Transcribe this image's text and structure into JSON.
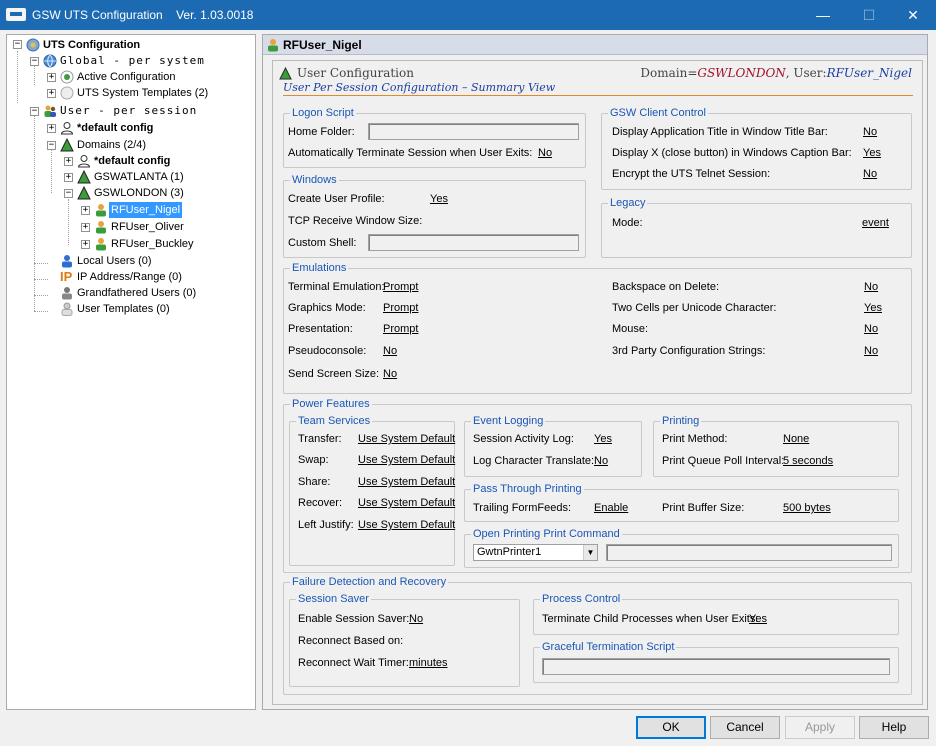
{
  "window": {
    "title": "GSW UTS Configuration",
    "version": "Ver. 1.03.0018",
    "minimize": "—",
    "maximize": "☐",
    "close": "✕"
  },
  "tree": {
    "root": "UTS Configuration",
    "global": "Global - per system",
    "active_config": "Active Configuration",
    "uts_templates": "UTS System Templates (2)",
    "user": "User - per session",
    "default_config": "*default config",
    "domains": "Domains (2/4)",
    "domain_default": "*default config",
    "gswatlanta": "GSWATLANTA (1)",
    "gswlondon": "GSWLONDON (3)",
    "users": [
      "RFUser_Nigel",
      "RFUser_Oliver",
      "RFUser_Buckley"
    ],
    "local_users": "Local Users (0)",
    "ip_address": "IP Address/Range (0)",
    "grandfathered": "Grandfathered Users (0)",
    "user_templates": "User Templates (0)",
    "ip_text": "IP"
  },
  "main": {
    "header": "RFUser_Nigel",
    "section_title": "User Configuration",
    "domain_label": "Domain=",
    "domain_value": "GSWLONDON",
    "user_label": ", User:",
    "user_value": "RFUser_Nigel",
    "subtitle": "User Per Session Configuration – Summary View"
  },
  "logon": {
    "title": "Logon Script",
    "home_folder": "Home Folder:",
    "auto_terminate": "Automatically Terminate Session when User Exits:",
    "auto_terminate_val": "No"
  },
  "windows": {
    "title": "Windows",
    "create_profile": "Create User Profile:",
    "create_profile_val": "Yes",
    "tcp_window": "TCP Receive Window Size:",
    "custom_shell": "Custom Shell:"
  },
  "client": {
    "title": "GSW Client Control",
    "app_title": "Display Application Title in Window Title Bar:",
    "app_title_val": "No",
    "display_x": "Display X (close button) in Windows Caption Bar:",
    "display_x_val": "Yes",
    "encrypt": "Encrypt the UTS Telnet Session:",
    "encrypt_val": "No"
  },
  "legacy": {
    "title": "Legacy",
    "mode": "Mode:",
    "mode_val": "event"
  },
  "emulations": {
    "title": "Emulations",
    "left": [
      {
        "label": "Terminal Emulation:",
        "value": "Prompt"
      },
      {
        "label": "Graphics Mode:",
        "value": "Prompt"
      },
      {
        "label": "Presentation:",
        "value": "Prompt"
      },
      {
        "label": "Pseudoconsole:",
        "value": "No"
      },
      {
        "label": "Send Screen Size:",
        "value": "No"
      }
    ],
    "right": [
      {
        "label": "Backspace on Delete:",
        "value": "No"
      },
      {
        "label": "Two Cells per Unicode Character:",
        "value": "Yes"
      },
      {
        "label": "Mouse:",
        "value": "No"
      },
      {
        "label": "3rd Party Configuration Strings:",
        "value": "No"
      }
    ]
  },
  "power": {
    "title": "Power Features",
    "team": {
      "title": "Team Services",
      "rows": [
        {
          "label": "Transfer:",
          "value": "Use System Default"
        },
        {
          "label": "Swap:",
          "value": "Use System Default"
        },
        {
          "label": "Share:",
          "value": "Use System Default"
        },
        {
          "label": "Recover:",
          "value": "Use System Default"
        },
        {
          "label": "Left Justify:",
          "value": "Use System Default"
        }
      ]
    },
    "event": {
      "title": "Event Logging",
      "activity": "Session Activity Log:",
      "activity_val": "Yes",
      "translate": "Log Character Translate:",
      "translate_val": "No"
    },
    "printing": {
      "title": "Printing",
      "method": "Print Method:",
      "method_val": "None",
      "poll": "Print Queue Poll Interval:",
      "poll_val": "5 seconds"
    },
    "pass": {
      "title": "Pass Through Printing",
      "trailing": "Trailing FormFeeds:",
      "trailing_val": "Enable",
      "buffer": "Print Buffer Size:",
      "buffer_val": "500 bytes"
    },
    "open": {
      "title": "Open Printing Print Command",
      "printer": "GwtnPrinter1"
    }
  },
  "failure": {
    "title": "Failure Detection and Recovery",
    "saver": {
      "title": "Session Saver",
      "enable": "Enable Session Saver:",
      "enable_val": "No",
      "reconnect": "Reconnect Based on:",
      "wait": "Reconnect Wait Timer:",
      "wait_val": "minutes"
    },
    "process": {
      "title": "Process Control",
      "terminate": "Terminate Child Processes when User Exits:",
      "terminate_val": "Yes"
    },
    "graceful": {
      "title": "Graceful Termination Script"
    }
  },
  "buttons": {
    "ok": "OK",
    "cancel": "Cancel",
    "apply": "Apply",
    "help": "Help"
  }
}
